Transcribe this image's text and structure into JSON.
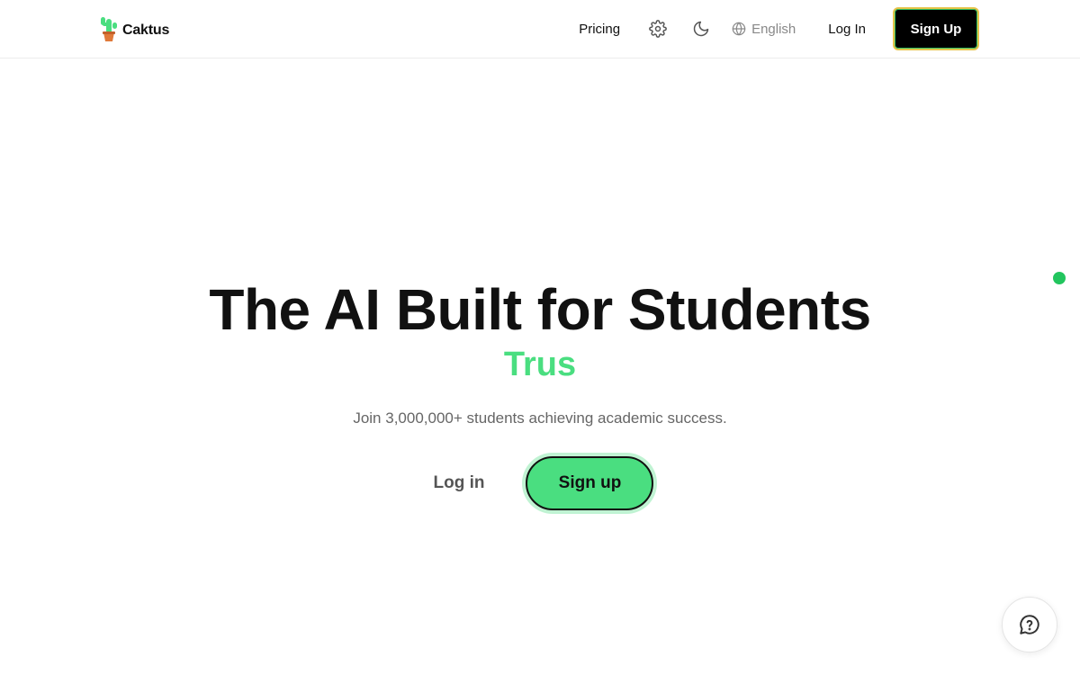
{
  "brand": {
    "name": "Caktus",
    "accent": "#4ade80"
  },
  "nav": {
    "pricing": "Pricing",
    "settings_icon": "gear-icon",
    "theme_icon": "moon-icon",
    "language": "English",
    "language_icon": "globe-icon",
    "login": "Log In",
    "signup": "Sign Up"
  },
  "hero": {
    "title": "The AI Built for Students",
    "typed_text": "Trus",
    "subtitle": "Join 3,000,000+ students achieving academic success.",
    "login": "Log in",
    "signup": "Sign up"
  },
  "widgets": {
    "chat_icon": "chat-help-icon",
    "status_color": "#22c55e"
  }
}
